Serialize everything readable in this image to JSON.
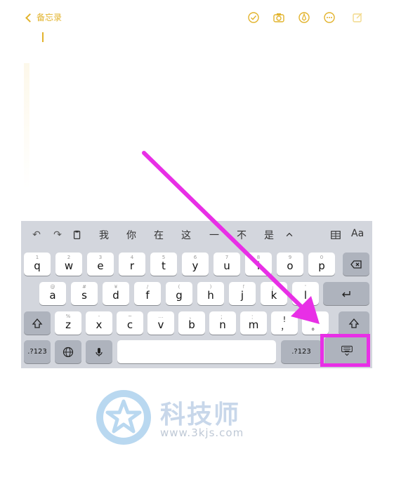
{
  "notes": {
    "back_label": "备忘录",
    "icons": [
      "checklist-icon",
      "camera-icon",
      "markup-icon",
      "more-icon",
      "compose-icon"
    ]
  },
  "keyboard": {
    "suggestions": [
      "我",
      "你",
      "在",
      "这",
      "一",
      "不",
      "是"
    ],
    "toolbar_right": "Aa",
    "row1": [
      {
        "k": "q",
        "alt": "1"
      },
      {
        "k": "w",
        "alt": "2"
      },
      {
        "k": "e",
        "alt": "3"
      },
      {
        "k": "r",
        "alt": "4"
      },
      {
        "k": "t",
        "alt": "5"
      },
      {
        "k": "y",
        "alt": "6"
      },
      {
        "k": "u",
        "alt": "7"
      },
      {
        "k": "i",
        "alt": "8"
      },
      {
        "k": "o",
        "alt": "9"
      },
      {
        "k": "p",
        "alt": "0"
      }
    ],
    "row2": [
      {
        "k": "a",
        "alt": "@"
      },
      {
        "k": "s",
        "alt": "#"
      },
      {
        "k": "d",
        "alt": "¥"
      },
      {
        "k": "f",
        "alt": "/"
      },
      {
        "k": "g",
        "alt": "("
      },
      {
        "k": "h",
        "alt": ")"
      },
      {
        "k": "j",
        "alt": "「"
      },
      {
        "k": "k",
        "alt": "」"
      },
      {
        "k": "l",
        "alt": "'"
      }
    ],
    "row3": [
      {
        "k": "z",
        "alt": "%"
      },
      {
        "k": "x",
        "alt": "-"
      },
      {
        "k": "c",
        "alt": "~"
      },
      {
        "k": "v",
        "alt": "…"
      },
      {
        "k": "b",
        "alt": "、"
      },
      {
        "k": "n",
        "alt": "；"
      },
      {
        "k": "m",
        "alt": "："
      },
      {
        "k": "!\n，",
        "alt": ""
      },
      {
        "k": "?\n。",
        "alt": ""
      }
    ],
    "numeric_left": ".?123",
    "numeric_right": ".?123"
  },
  "watermark": {
    "title": "科技师",
    "url": "www.3kjs.com"
  },
  "colors": {
    "accent": "#e2b32c",
    "annotation": "#e82fe6",
    "keyboard_bg": "#d3d6dd",
    "watermark": "#c8d7ea"
  }
}
